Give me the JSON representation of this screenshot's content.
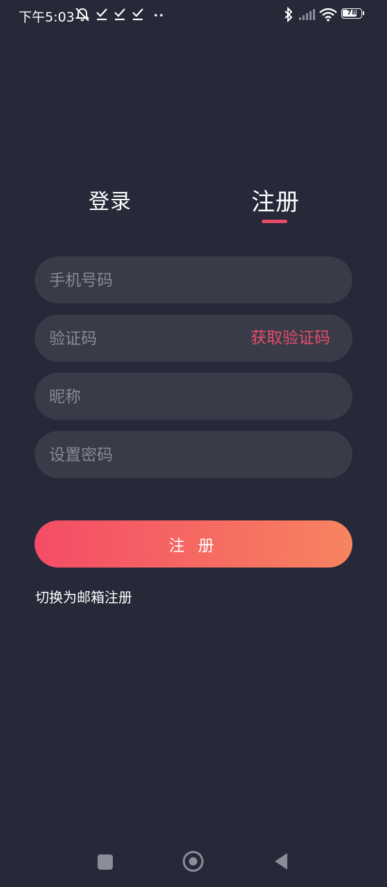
{
  "status_bar": {
    "time": "下午5:03",
    "battery": "78",
    "battery_level": 0.78
  },
  "tabs": [
    {
      "label": "登录",
      "active": false
    },
    {
      "label": "注册",
      "active": true
    }
  ],
  "form": {
    "phone_placeholder": "手机号码",
    "code_placeholder": "验证码",
    "get_code_label": "获取验证码",
    "nickname_placeholder": "昵称",
    "password_placeholder": "设置密码",
    "submit_label": "注 册",
    "switch_label": "切换为邮箱注册"
  },
  "colors": {
    "background": "#252938",
    "accent": "#e84a6a",
    "field_bg": "#393c48",
    "button_gradient_start": "#f44c66",
    "button_gradient_end": "#f7845f"
  },
  "icons": [
    "mute-icon",
    "check-icon",
    "dots-icon",
    "bluetooth-icon",
    "signal-icon",
    "wifi-icon",
    "battery-icon",
    "recent-apps-icon",
    "home-icon",
    "back-icon"
  ]
}
